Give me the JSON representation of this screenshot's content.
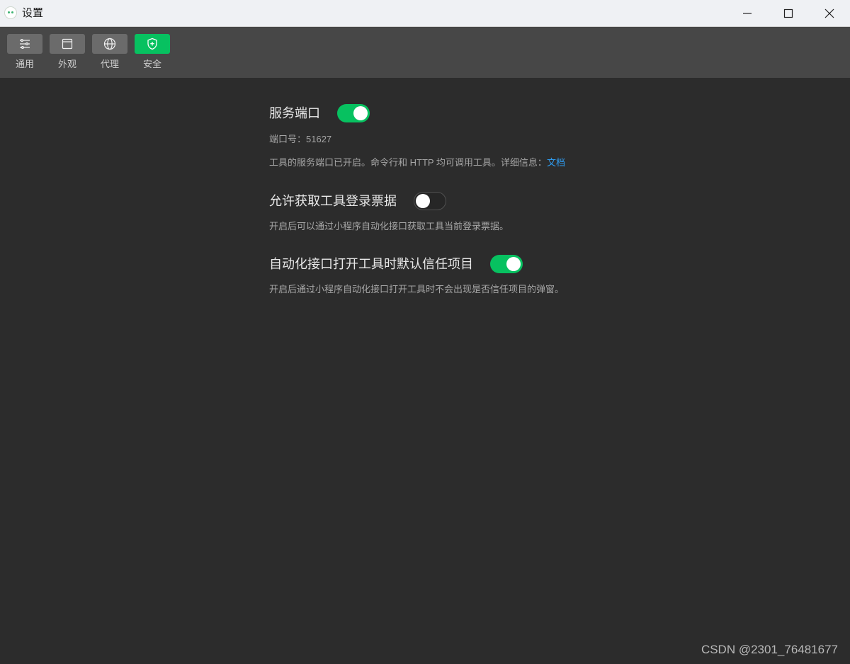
{
  "window": {
    "title": "设置"
  },
  "toolbar": {
    "tabs": [
      {
        "label": "通用",
        "icon": "sliders-icon"
      },
      {
        "label": "外观",
        "icon": "window-icon"
      },
      {
        "label": "代理",
        "icon": "globe-icon"
      },
      {
        "label": "安全",
        "icon": "shield-icon",
        "active": true
      }
    ],
    "active_color": "#07c160"
  },
  "settings": {
    "service_port": {
      "title": "服务端口",
      "enabled": true,
      "port_label": "端口号：51627",
      "description": "工具的服务端口已开启。命令行和 HTTP 均可调用工具。详细信息：",
      "link_text": "文档"
    },
    "allow_ticket": {
      "title": "允许获取工具登录票据",
      "enabled": false,
      "description": "开启后可以通过小程序自动化接口获取工具当前登录票据。"
    },
    "trust_project": {
      "title": "自动化接口打开工具时默认信任项目",
      "enabled": true,
      "description": "开启后通过小程序自动化接口打开工具时不会出现是否信任项目的弹窗。"
    }
  },
  "watermark": "CSDN @2301_76481677"
}
